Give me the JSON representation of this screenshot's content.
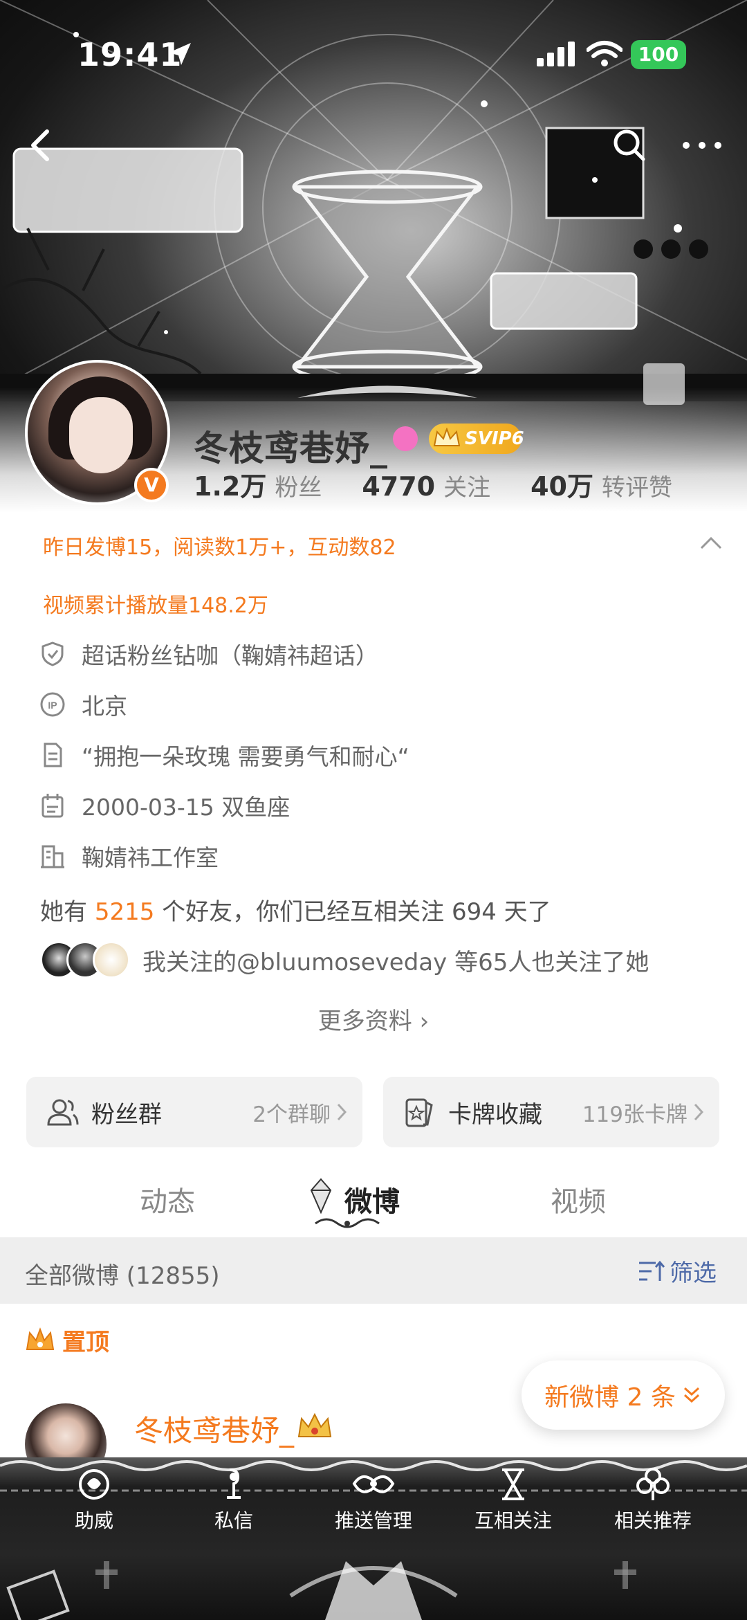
{
  "status_bar": {
    "time": "19:41",
    "battery": "100"
  },
  "profile": {
    "username": "冬枝鸢巷妤_",
    "svip": "SVIP6",
    "stats": [
      {
        "value": "1.2万",
        "label": "粉丝"
      },
      {
        "value": "4770",
        "label": "关注"
      },
      {
        "value": "40万",
        "label": "转评赞"
      }
    ]
  },
  "highlights": {
    "line1": "昨日发博15，阅读数1万+，互动数82",
    "line2": "视频累计播放量148.2万"
  },
  "info": {
    "super_topic": "超话粉丝钻咖（鞠婧祎超话）",
    "ip": "北京",
    "bio": "“拥抱一朵玫瑰 需要勇气和耐心“",
    "birthday": "2000-03-15 双鱼座",
    "company": "鞠婧祎工作室"
  },
  "friends": {
    "prefix": "她有 ",
    "count": "5215",
    "suffix": " 个好友，你们已经互相关注 694 天了"
  },
  "mutual": {
    "text": "我关注的@bluumoseveday 等65人也关注了她"
  },
  "more_info": "更多资料 ›",
  "cards": {
    "fans_group": {
      "title": "粉丝群",
      "value": "2个群聊"
    },
    "card_collection": {
      "title": "卡牌收藏",
      "value": "119张卡牌"
    }
  },
  "tabs": {
    "dynamics": "动态",
    "weibo": "微博",
    "video": "视频"
  },
  "filter": {
    "all": "全部微博 (12855)",
    "filter_label": "筛选"
  },
  "pinned": {
    "label": "置顶"
  },
  "post": {
    "author": "冬枝鸢巷妤_"
  },
  "new_posts": "新微博 2 条",
  "bottom_nav": {
    "cheer": "助威",
    "message": "私信",
    "push": "推送管理",
    "mutual_follow": "互相关注",
    "recommend": "相关推荐"
  },
  "colors": {
    "accent_orange": "#f47a1f",
    "filter_blue": "#4e6aa8",
    "svip_gold": "#f0a81e",
    "battery_green": "#34c759"
  }
}
